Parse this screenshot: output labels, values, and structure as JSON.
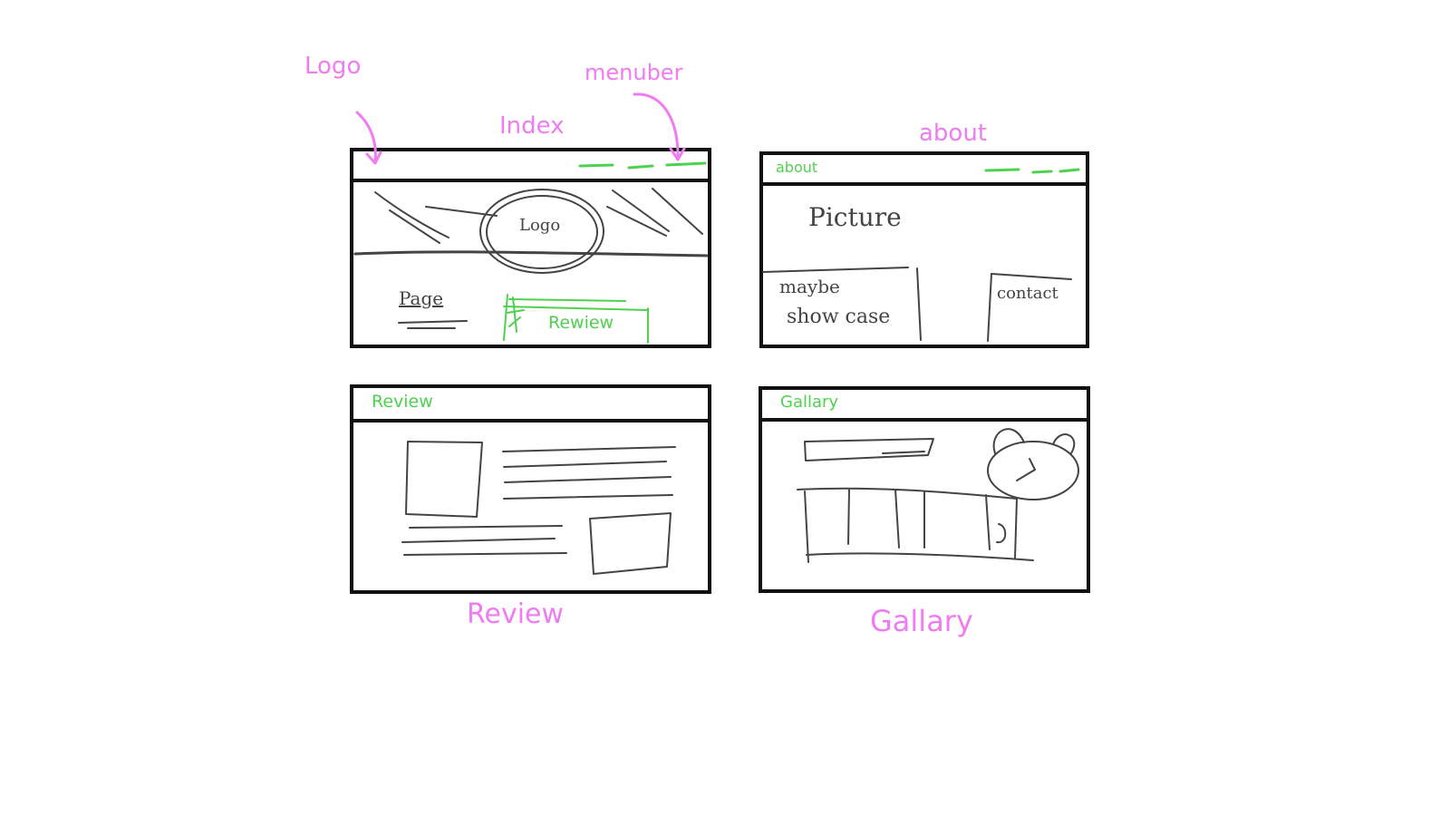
{
  "annotations": {
    "logo": "Logo",
    "menubar": "menuber",
    "index": "Index",
    "about": "about",
    "review": "Review",
    "gallery": "Gallary"
  },
  "index_page": {
    "hero_logo": "Logo",
    "page_link": "Page",
    "review_link": "Rewiew"
  },
  "about_page": {
    "header_label": "about",
    "picture": "Picture",
    "showcase": [
      "maybe",
      "show case"
    ],
    "contact": "contact"
  },
  "review_page": {
    "header_label": "Review"
  },
  "gallery_page": {
    "header_label": "Gallary"
  },
  "colors": {
    "annotation": "#f07cf2",
    "marker": "#4fd14f",
    "ink": "#111111"
  }
}
